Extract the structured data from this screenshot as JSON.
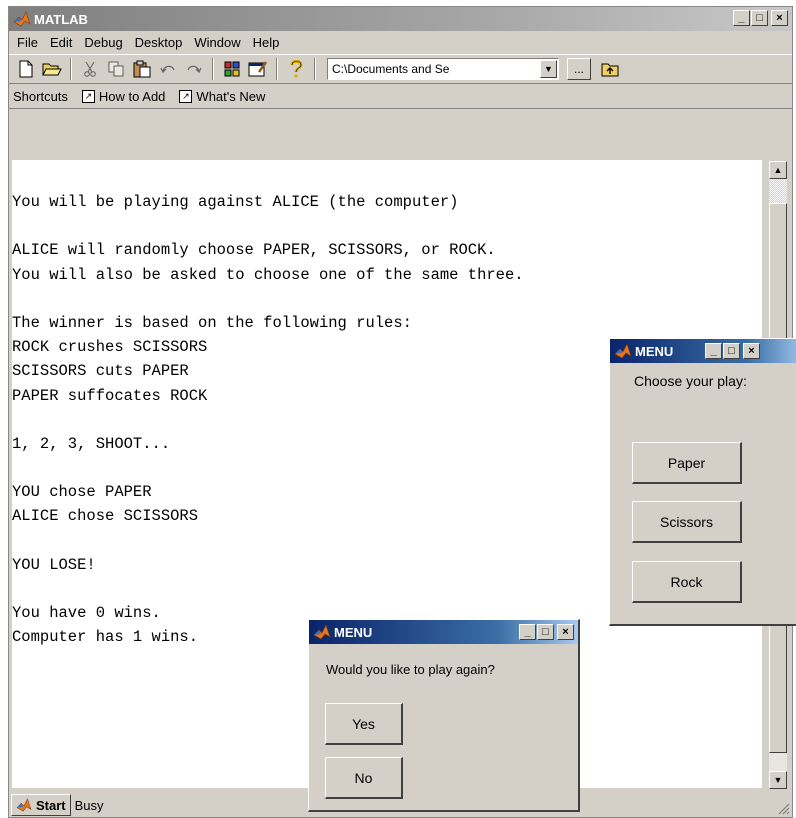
{
  "main_window": {
    "title": "MATLAB",
    "controls": {
      "minimize": "_",
      "maximize": "□",
      "close": "×"
    }
  },
  "menubar": [
    "File",
    "Edit",
    "Debug",
    "Desktop",
    "Window",
    "Help"
  ],
  "toolbar": {
    "current_directory": "C:\\Documents and Se",
    "browse_label": "..."
  },
  "shortcuts": {
    "label": "Shortcuts",
    "items": [
      "How to Add",
      "What's New"
    ]
  },
  "command_window": {
    "lines": [
      "You will be playing against ALICE (the computer)",
      "",
      "ALICE will randomly choose PAPER, SCISSORS, or ROCK.",
      "You will also be asked to choose one of the same three.",
      "",
      "The winner is based on the following rules:",
      "ROCK crushes SCISSORS",
      "SCISSORS cuts PAPER",
      "PAPER suffocates ROCK",
      "",
      "1, 2, 3, SHOOT...",
      "",
      "YOU chose PAPER",
      "ALICE chose SCISSORS",
      "",
      "YOU LOSE!",
      "",
      "You have 0 wins.",
      "Computer has 1 wins."
    ]
  },
  "statusbar": {
    "start_label": "Start",
    "status": "Busy"
  },
  "play_dialog": {
    "title": "MENU",
    "prompt": "Choose your play:",
    "buttons": [
      "Paper",
      "Scissors",
      "Rock"
    ]
  },
  "again_dialog": {
    "title": "MENU",
    "prompt": "Would you like to play again?",
    "buttons": [
      "Yes",
      "No"
    ]
  },
  "colors": {
    "inactive_title": "#a6a6a6",
    "active_title": "#0a246a",
    "face": "#d4d0c8",
    "matlab_logo": "#e8741c"
  }
}
